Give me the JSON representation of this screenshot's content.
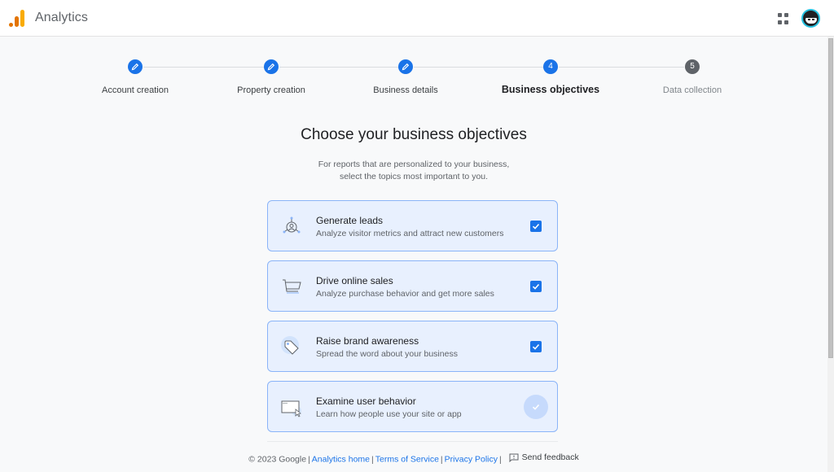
{
  "app": {
    "title": "Analytics",
    "logo_colors": [
      "#e37400",
      "#f9ab00"
    ]
  },
  "header": {
    "apps_icon": "apps-grid-icon",
    "avatar_icon": "ninja-avatar"
  },
  "stepper": {
    "steps": [
      {
        "label": "Account creation",
        "state": "completed",
        "icon": "edit-pencil-icon"
      },
      {
        "label": "Property creation",
        "state": "completed",
        "icon": "edit-pencil-icon"
      },
      {
        "label": "Business details",
        "state": "completed",
        "icon": "edit-pencil-icon"
      },
      {
        "label": "Business objectives",
        "state": "active",
        "number": "4"
      },
      {
        "label": "Data collection",
        "state": "pending",
        "number": "5"
      }
    ]
  },
  "main": {
    "heading": "Choose your business objectives",
    "subtext_line1": "For reports that are personalized to your business,",
    "subtext_line2": "select the topics most important to you.",
    "objectives": [
      {
        "title": "Generate leads",
        "description": "Analyze visitor metrics and attract new customers",
        "checked": true,
        "icon": "lead-target-icon"
      },
      {
        "title": "Drive online sales",
        "description": "Analyze purchase behavior and get more sales",
        "checked": true,
        "icon": "shopping-cart-icon"
      },
      {
        "title": "Raise brand awareness",
        "description": "Spread the word about your business",
        "checked": true,
        "icon": "price-tag-icon"
      },
      {
        "title": "Examine user behavior",
        "description": "Learn how people use your site or app",
        "checked": true,
        "icon": "browser-cursor-icon",
        "focused": true
      }
    ]
  },
  "footer": {
    "copyright": "© 2023 Google",
    "links": [
      "Analytics home",
      "Terms of Service",
      "Privacy Policy"
    ],
    "feedback_label": "Send feedback"
  },
  "colors": {
    "accent": "#1a73e8",
    "card_bg": "#e8f0fe",
    "card_border": "#8ab4f8",
    "page_bg": "#f8f9fa"
  }
}
